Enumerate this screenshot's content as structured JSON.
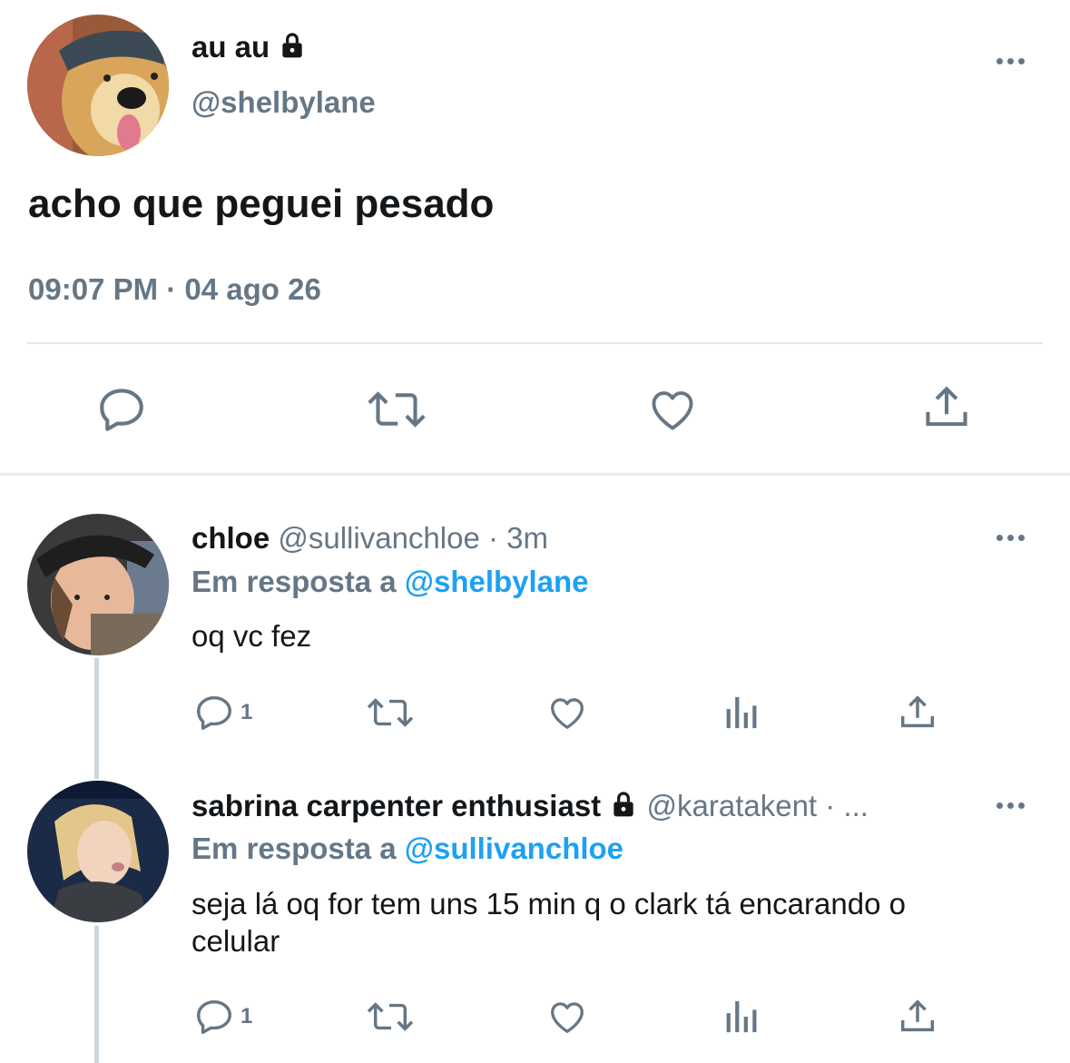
{
  "main_tweet": {
    "display_name": "au au",
    "handle": "@shelbylane",
    "text": "acho que peguei pesado",
    "timestamp": "09:07 PM · 04 ago 26",
    "protected": true
  },
  "replies": [
    {
      "display_name": "chloe",
      "handle": "@sullivanchloe",
      "time": "· 3m",
      "reply_prefix": "Em resposta a",
      "reply_to": "@shelbylane",
      "text": "oq vc fez",
      "reply_count": "1"
    },
    {
      "display_name": "sabrina carpenter enthusiast",
      "handle": "@karatakent",
      "time": "· ...",
      "reply_prefix": "Em resposta a",
      "reply_to": "@sullivanchloe",
      "text_line1": "seja lá oq for tem uns 15 min q o clark tá encarando o",
      "text_line2": "celular",
      "reply_count": "1",
      "protected": true
    }
  ],
  "icons": [
    "reply-icon",
    "retweet-icon",
    "like-icon",
    "share-icon",
    "analytics-icon",
    "more-icon",
    "lock-icon"
  ],
  "colors": {
    "text": "#14171a",
    "secondary": "#657786",
    "link": "#1da1f2",
    "divider": "#e1e8ed"
  }
}
